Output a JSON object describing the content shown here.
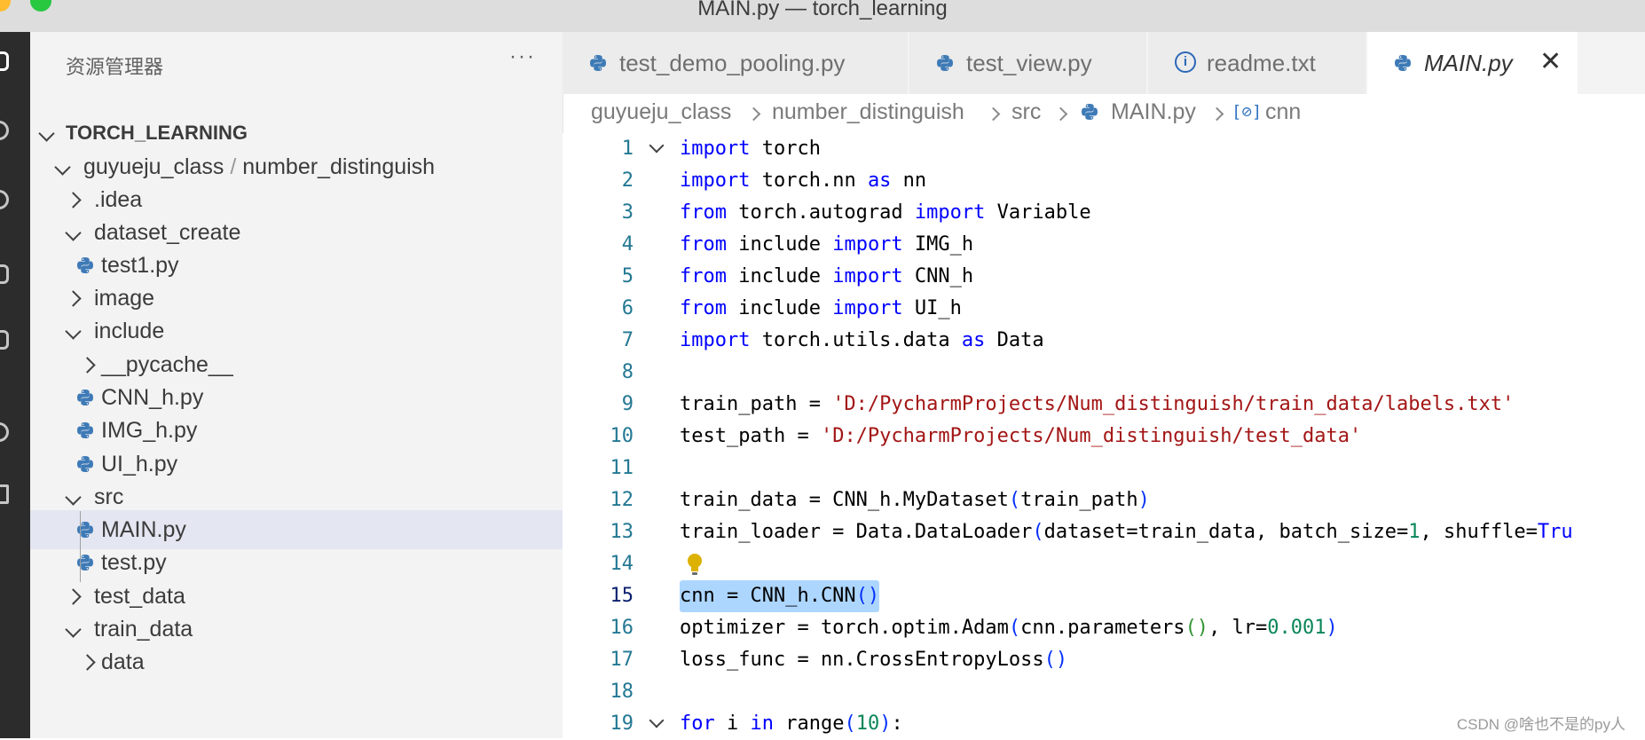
{
  "window": {
    "title": "MAIN.py — torch_learning"
  },
  "colors": {
    "traffic_yellow": "#febc2e",
    "traffic_green": "#28c840",
    "python_icon": "#3e7ab6",
    "selection": "#add6ff"
  },
  "sidebar": {
    "header": "资源管理器",
    "more": "···",
    "project": "TORCH_LEARNING",
    "tree": [
      {
        "label": "guyueju_class",
        "label2": "number_distinguish",
        "type": "folder",
        "expanded": true
      },
      {
        "label": ".idea",
        "type": "folder",
        "expanded": false
      },
      {
        "label": "dataset_create",
        "type": "folder",
        "expanded": true
      },
      {
        "label": "test1.py",
        "type": "file"
      },
      {
        "label": "image",
        "type": "folder",
        "expanded": false
      },
      {
        "label": "include",
        "type": "folder",
        "expanded": true
      },
      {
        "label": "__pycache__",
        "type": "folder",
        "expanded": false
      },
      {
        "label": "CNN_h.py",
        "type": "file"
      },
      {
        "label": "IMG_h.py",
        "type": "file"
      },
      {
        "label": "UI_h.py",
        "type": "file"
      },
      {
        "label": "src",
        "type": "folder",
        "expanded": true
      },
      {
        "label": "MAIN.py",
        "type": "file",
        "selected": true
      },
      {
        "label": "test.py",
        "type": "file"
      },
      {
        "label": "test_data",
        "type": "folder",
        "expanded": false
      },
      {
        "label": "train_data",
        "type": "folder",
        "expanded": true
      },
      {
        "label": "data",
        "type": "folder",
        "expanded": false
      }
    ]
  },
  "tabs": [
    {
      "label": "test_demo_pooling.py",
      "icon": "python-icon"
    },
    {
      "label": "test_view.py",
      "icon": "python-icon"
    },
    {
      "label": "readme.txt",
      "icon": "info-icon"
    },
    {
      "label": "MAIN.py",
      "icon": "python-icon",
      "active": true
    }
  ],
  "breadcrumb": [
    "guyueju_class",
    "number_distinguish",
    "src",
    "MAIN.py",
    "cnn"
  ],
  "editor": {
    "active_line": 15,
    "lines": [
      {
        "n": "1",
        "text": "import torch"
      },
      {
        "n": "2",
        "text": "import torch.nn as nn"
      },
      {
        "n": "3",
        "text": "from torch.autograd import Variable"
      },
      {
        "n": "4",
        "text": "from include import IMG_h"
      },
      {
        "n": "5",
        "text": "from include import CNN_h"
      },
      {
        "n": "6",
        "text": "from include import UI_h"
      },
      {
        "n": "7",
        "text": "import torch.utils.data as Data"
      },
      {
        "n": "8",
        "text": ""
      },
      {
        "n": "9",
        "text": "train_path = 'D:/PycharmProjects/Num_distinguish/train_data/labels.txt'"
      },
      {
        "n": "10",
        "text": "test_path = 'D:/PycharmProjects/Num_distinguish/test_data'"
      },
      {
        "n": "11",
        "text": ""
      },
      {
        "n": "12",
        "text": "train_data = CNN_h.MyDataset(train_path)"
      },
      {
        "n": "13",
        "text": "train_loader = Data.DataLoader(dataset=train_data, batch_size=1, shuffle=Tru"
      },
      {
        "n": "14",
        "text": ""
      },
      {
        "n": "15",
        "text": "cnn = CNN_h.CNN()"
      },
      {
        "n": "16",
        "text": "optimizer = torch.optim.Adam(cnn.parameters(), lr=0.001)"
      },
      {
        "n": "17",
        "text": "loss_func = nn.CrossEntropyLoss()"
      },
      {
        "n": "18",
        "text": ""
      },
      {
        "n": "19",
        "text": "for i in range(10):"
      }
    ]
  },
  "watermark": "CSDN @啥也不是的py人"
}
